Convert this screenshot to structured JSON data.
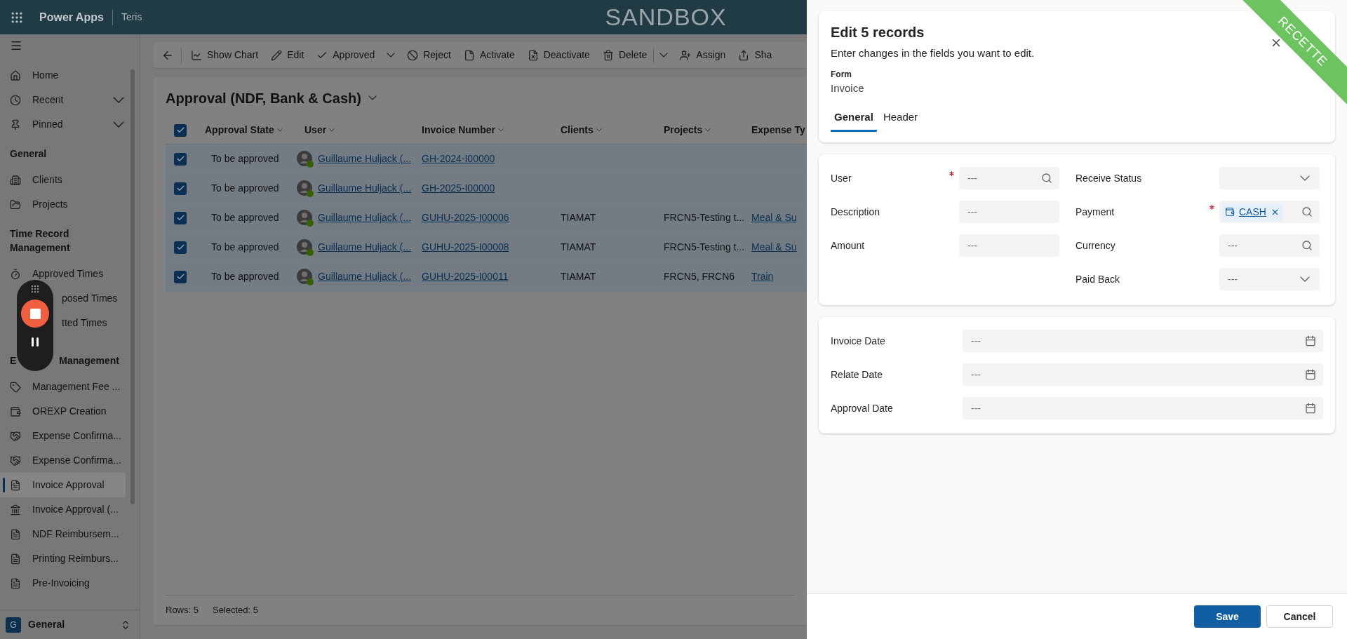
{
  "header": {
    "app_name": "Power Apps",
    "environment": "Teris",
    "banner": "SANDBOX"
  },
  "sidebar": {
    "top": [
      {
        "label": "Home",
        "expandable": false
      },
      {
        "label": "Recent",
        "expandable": true
      },
      {
        "label": "Pinned",
        "expandable": true
      }
    ],
    "groups": [
      {
        "heading": [
          "General"
        ],
        "items": [
          {
            "label": "Clients",
            "kind": "item",
            "selected": false
          },
          {
            "label": "Projects",
            "kind": "item",
            "selected": false
          }
        ]
      },
      {
        "heading": [
          "Time Record Management"
        ],
        "items": [
          {
            "label": "Approved Times",
            "kind": "item",
            "selected": false
          },
          {
            "label": "posed Times",
            "kind": "partial",
            "selected": false
          },
          {
            "label": "tted Times",
            "kind": "partial",
            "selected": false
          }
        ]
      },
      {
        "heading": [
          "E",
          "Management"
        ],
        "items": [
          {
            "label": "Management Fee ...",
            "kind": "item",
            "selected": false
          },
          {
            "label": "OREXP Creation",
            "kind": "item",
            "selected": false
          },
          {
            "label": "Expense Confirma...",
            "kind": "item",
            "selected": false
          },
          {
            "label": "Expense Confirma...",
            "kind": "item",
            "selected": false
          },
          {
            "label": "Invoice Approval",
            "kind": "item",
            "selected": true
          },
          {
            "label": "Invoice Approval (...",
            "kind": "item",
            "selected": false
          },
          {
            "label": "NDF Reimbursem...",
            "kind": "item",
            "selected": false
          },
          {
            "label": "Printing Reimburs...",
            "kind": "item",
            "selected": false
          },
          {
            "label": "Pre-Invoicing",
            "kind": "item",
            "selected": false
          }
        ]
      }
    ],
    "area": {
      "initial": "G",
      "label": "General"
    }
  },
  "toolbar": [
    {
      "label": "Show Chart",
      "split": false
    },
    {
      "label": "Edit",
      "split": false
    },
    {
      "label": "Approved",
      "split": true
    },
    {
      "label": "Reject",
      "split": false
    },
    {
      "label": "Activate",
      "split": false
    },
    {
      "label": "Deactivate",
      "split": false
    },
    {
      "label": "Delete",
      "split": true
    },
    {
      "label": "Assign",
      "split": false
    },
    {
      "label": "Sha",
      "split": false
    }
  ],
  "view": {
    "title": "Approval (NDF, Bank & Cash)",
    "all_checked": true,
    "columns": [
      "Approval State",
      "User",
      "Invoice Number",
      "Clients",
      "Projects",
      "Expense Ty"
    ],
    "rows": [
      {
        "checked": true,
        "state": "To be approved",
        "user": "Guillaume Huljack (...",
        "online": true,
        "invoice": "GH-2024-I00000",
        "client": "",
        "project": "",
        "expense": ""
      },
      {
        "checked": true,
        "state": "To be approved",
        "user": "Guillaume Huljack (...",
        "online": true,
        "invoice": "GH-2025-I00000",
        "client": "",
        "project": "",
        "expense": ""
      },
      {
        "checked": true,
        "state": "To be approved",
        "user": "Guillaume Huljack (...",
        "online": true,
        "invoice": "GUHU-2025-I00006",
        "client": "TIAMAT",
        "project": "FRCN5-Testing t...",
        "expense": "Meal & Su"
      },
      {
        "checked": true,
        "state": "To be approved",
        "user": "Guillaume Huljack (...",
        "online": true,
        "invoice": "GUHU-2025-I00008",
        "client": "TIAMAT",
        "project": "FRCN5-Testing t...",
        "expense": "Meal & Su"
      },
      {
        "checked": true,
        "state": "To be approved",
        "user": "Guillaume Huljack (...",
        "online": true,
        "invoice": "GUHU-2025-I00011",
        "client": "TIAMAT",
        "project": "FRCN5,  FRCN6",
        "expense": "Train"
      }
    ],
    "footer": {
      "rows": "Rows: 5",
      "selected": "Selected: 5"
    }
  },
  "panel": {
    "title": "Edit 5 records",
    "subtitle": "Enter changes in the fields you want to edit.",
    "form_label": "Form",
    "form_name": "Invoice",
    "ribbon": "RECETTE",
    "tabs": [
      {
        "label": "General",
        "selected": true
      },
      {
        "label": "Header",
        "selected": false
      }
    ],
    "left_fields": [
      {
        "label": "User",
        "required": true,
        "kind": "lookup",
        "placeholder": "---"
      },
      {
        "label": "Description",
        "required": false,
        "kind": "text",
        "placeholder": "---"
      },
      {
        "label": "Amount",
        "required": false,
        "kind": "text",
        "placeholder": "---"
      }
    ],
    "right_fields": [
      {
        "label": "Receive Status",
        "required": false,
        "kind": "select"
      },
      {
        "label": "Payment",
        "required": true,
        "kind": "tag",
        "value": "CASH"
      },
      {
        "label": "Currency",
        "required": false,
        "kind": "lookup",
        "placeholder": "---"
      },
      {
        "label": "Paid Back",
        "required": false,
        "kind": "select",
        "placeholder": "---"
      }
    ],
    "date_fields": [
      {
        "label": "Invoice Date",
        "placeholder": "---"
      },
      {
        "label": "Relate Date",
        "placeholder": "---"
      },
      {
        "label": "Approval Date",
        "placeholder": "---"
      }
    ],
    "buttons": [
      {
        "label": "Save",
        "primary": true
      },
      {
        "label": "Cancel",
        "primary": false
      }
    ]
  }
}
